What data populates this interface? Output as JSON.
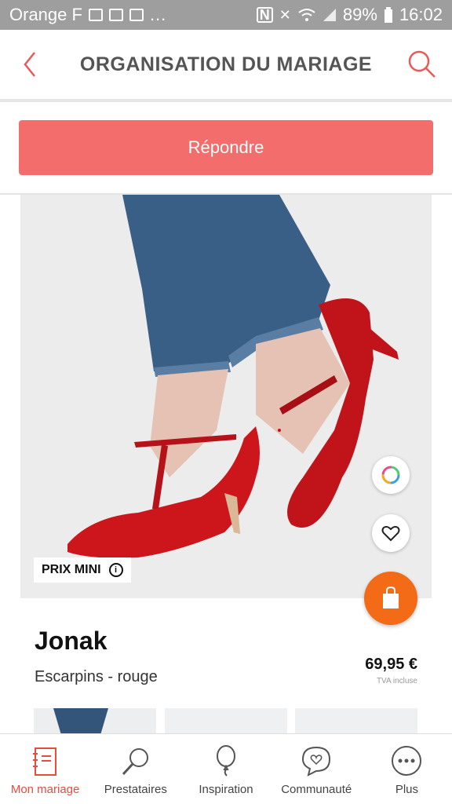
{
  "status_bar": {
    "carrier": "Orange F",
    "more": "...",
    "battery": "89%",
    "time": "16:02"
  },
  "header": {
    "title": "ORGANISATION DU MARIAGE"
  },
  "reply_button": {
    "label": "Répondre"
  },
  "product": {
    "badge": "PRIX MINI",
    "brand": "Jonak",
    "description": "Escarpins - rouge",
    "price": "69,95 €",
    "tax_note": "TVA incluse"
  },
  "bottom_nav": {
    "items": [
      {
        "label": "Mon mariage",
        "icon": "notebook-icon"
      },
      {
        "label": "Prestataires",
        "icon": "magnifier-icon"
      },
      {
        "label": "Inspiration",
        "icon": "balloon-icon"
      },
      {
        "label": "Communauté",
        "icon": "chat-heart-icon"
      },
      {
        "label": "Plus",
        "icon": "more-icon"
      }
    ]
  },
  "colors": {
    "accent": "#f46d6d",
    "active_nav": "#e74c3c",
    "cart": "#f36a17",
    "status_bar": "#9e9e9e"
  }
}
